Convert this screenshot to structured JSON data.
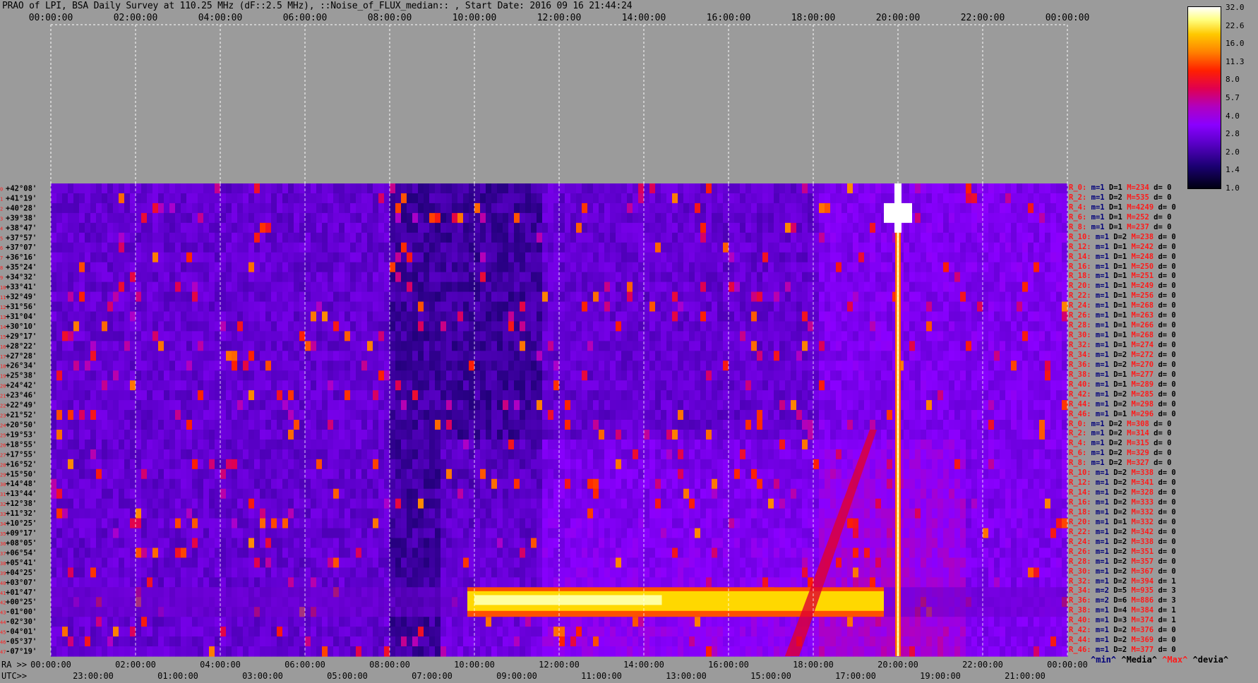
{
  "title": "PRAO of LPI, BSA Daily Survey at 110.25 MHz (dF::2.5 MHz), ::Noise_of_FLUX_median:: , Start Date: 2016 09 16 21:44:24",
  "chart_data": {
    "type": "heatmap",
    "top_axis_labels": [
      "00:00:00",
      "02:00:00",
      "04:00:00",
      "06:00:00",
      "08:00:00",
      "10:00:00",
      "12:00:00",
      "14:00:00",
      "16:00:00",
      "18:00:00",
      "20:00:00",
      "22:00:00",
      "00:00:00"
    ],
    "ra_label": "RA >>",
    "utc_label": "UTC>>",
    "ra_axis_labels": [
      "00:00:00",
      "02:00:00",
      "04:00:00",
      "06:00:00",
      "08:00:00",
      "10:00:00",
      "12:00:00",
      "14:00:00",
      "16:00:00",
      "18:00:00",
      "20:00:00",
      "22:00:00",
      "00:00:00"
    ],
    "utc_axis_labels": [
      "23:00:00",
      "01:00:00",
      "03:00:00",
      "05:00:00",
      "07:00:00",
      "09:00:00",
      "11:00:00",
      "13:00:00",
      "15:00:00",
      "17:00:00",
      "19:00:00",
      "21:00:00"
    ],
    "declinations": [
      "+42°08'",
      "+41°19'",
      "+40°28'",
      "+39°38'",
      "+38°47'",
      "+37°57'",
      "+37°07'",
      "+36°16'",
      "+35°24'",
      "+34°32'",
      "+33°41'",
      "+32°49'",
      "+31°56'",
      "+31°04'",
      "+30°10'",
      "+29°17'",
      "+28°22'",
      "+27°28'",
      "+26°34'",
      "+25°38'",
      "+24°42'",
      "+23°46'",
      "+22°49'",
      "+21°52'",
      "+20°50'",
      "+19°53'",
      "+18°55'",
      "+17°55'",
      "+16°52'",
      "+15°50'",
      "+14°48'",
      "+13°44'",
      "+12°38'",
      "+11°32'",
      "+10°25'",
      "+09°17'",
      "+08°05'",
      "+06°54'",
      "+05°41'",
      "+04°25'",
      "+03°07'",
      "+01°47'",
      "+00°25'",
      "-01°00'",
      "-02°30'",
      "-04°01'",
      "-05°37'",
      "-07°19'"
    ],
    "colorbar_ticks": [
      "32.0",
      "22.6",
      "16.0",
      "11.3",
      "8.0",
      "5.7",
      "4.0",
      "2.8",
      "2.0",
      "1.4",
      "1.0"
    ],
    "colorbar_scale": "log",
    "colorbar_colors": [
      "#000011",
      "#5a00c8",
      "#8a00ff",
      "#e00050",
      "#ff8000",
      "#ffff80",
      "#ffffff"
    ],
    "bright_band_dec": "+00°25'",
    "bright_band_ra_range": [
      "10:00:00",
      "18:00:00"
    ],
    "source_ra": "20:00:00",
    "source_dec_range": [
      "+42°08'",
      "-07°19'"
    ],
    "legend": {
      "min": "^min^",
      "median": "^Media^",
      "max": "^Max^",
      "devia": "^devia^"
    }
  },
  "rows": [
    {
      "r": "R_0:",
      "m": "m=1",
      "d": "D=1",
      "M": "M=234",
      "dv": "d= 0"
    },
    {
      "r": "R_2:",
      "m": "m=1",
      "d": "D=2",
      "M": "M=535",
      "dv": "d= 0"
    },
    {
      "r": "R_4:",
      "m": "m=1",
      "d": "D=1",
      "M": "M=4249",
      "dv": "d= 0"
    },
    {
      "r": "R_6:",
      "m": "m=1",
      "d": "D=1",
      "M": "M=252",
      "dv": "d= 0"
    },
    {
      "r": "R_8:",
      "m": "m=1",
      "d": "D=1",
      "M": "M=237",
      "dv": "d= 0"
    },
    {
      "r": "R_10:",
      "m": "m=1",
      "d": "D=2",
      "M": "M=238",
      "dv": "d= 0"
    },
    {
      "r": "R_12:",
      "m": "m=1",
      "d": "D=1",
      "M": "M=242",
      "dv": "d= 0"
    },
    {
      "r": "R_14:",
      "m": "m=1",
      "d": "D=1",
      "M": "M=248",
      "dv": "d= 0"
    },
    {
      "r": "R_16:",
      "m": "m=1",
      "d": "D=1",
      "M": "M=250",
      "dv": "d= 0"
    },
    {
      "r": "R_18:",
      "m": "m=1",
      "d": "D=1",
      "M": "M=251",
      "dv": "d= 0"
    },
    {
      "r": "R_20:",
      "m": "m=1",
      "d": "D=1",
      "M": "M=249",
      "dv": "d= 0"
    },
    {
      "r": "R_22:",
      "m": "m=1",
      "d": "D=1",
      "M": "M=256",
      "dv": "d= 0"
    },
    {
      "r": "R_24:",
      "m": "m=1",
      "d": "D=1",
      "M": "M=268",
      "dv": "d= 0"
    },
    {
      "r": "R_26:",
      "m": "m=1",
      "d": "D=1",
      "M": "M=263",
      "dv": "d= 0"
    },
    {
      "r": "R_28:",
      "m": "m=1",
      "d": "D=1",
      "M": "M=266",
      "dv": "d= 0"
    },
    {
      "r": "R_30:",
      "m": "m=1",
      "d": "D=1",
      "M": "M=268",
      "dv": "d= 0"
    },
    {
      "r": "R_32:",
      "m": "m=1",
      "d": "D=1",
      "M": "M=274",
      "dv": "d= 0"
    },
    {
      "r": "R_34:",
      "m": "m=1",
      "d": "D=2",
      "M": "M=272",
      "dv": "d= 0"
    },
    {
      "r": "R_36:",
      "m": "m=1",
      "d": "D=2",
      "M": "M=270",
      "dv": "d= 0"
    },
    {
      "r": "R_38:",
      "m": "m=1",
      "d": "D=1",
      "M": "M=277",
      "dv": "d= 0"
    },
    {
      "r": "R_40:",
      "m": "m=1",
      "d": "D=1",
      "M": "M=289",
      "dv": "d= 0"
    },
    {
      "r": "R_42:",
      "m": "m=1",
      "d": "D=2",
      "M": "M=285",
      "dv": "d= 0"
    },
    {
      "r": "R_44:",
      "m": "m=1",
      "d": "D=2",
      "M": "M=298",
      "dv": "d= 0"
    },
    {
      "r": "R_46:",
      "m": "m=1",
      "d": "D=1",
      "M": "M=296",
      "dv": "d= 0"
    },
    {
      "r": "R_0:",
      "m": "m=1",
      "d": "D=2",
      "M": "M=308",
      "dv": "d= 0"
    },
    {
      "r": "R_2:",
      "m": "m=1",
      "d": "D=2",
      "M": "M=314",
      "dv": "d= 0"
    },
    {
      "r": "R_4:",
      "m": "m=1",
      "d": "D=2",
      "M": "M=315",
      "dv": "d= 0"
    },
    {
      "r": "R_6:",
      "m": "m=1",
      "d": "D=2",
      "M": "M=329",
      "dv": "d= 0"
    },
    {
      "r": "R_8:",
      "m": "m=1",
      "d": "D=2",
      "M": "M=327",
      "dv": "d= 0"
    },
    {
      "r": "R_10:",
      "m": "m=1",
      "d": "D=2",
      "M": "M=338",
      "dv": "d= 0"
    },
    {
      "r": "R_12:",
      "m": "m=1",
      "d": "D=2",
      "M": "M=341",
      "dv": "d= 0"
    },
    {
      "r": "R_14:",
      "m": "m=1",
      "d": "D=2",
      "M": "M=328",
      "dv": "d= 0"
    },
    {
      "r": "R_16:",
      "m": "m=1",
      "d": "D=2",
      "M": "M=333",
      "dv": "d= 0"
    },
    {
      "r": "R_18:",
      "m": "m=1",
      "d": "D=2",
      "M": "M=332",
      "dv": "d= 0"
    },
    {
      "r": "R_20:",
      "m": "m=1",
      "d": "D=1",
      "M": "M=332",
      "dv": "d= 0"
    },
    {
      "r": "R_22:",
      "m": "m=1",
      "d": "D=2",
      "M": "M=342",
      "dv": "d= 0"
    },
    {
      "r": "R_24:",
      "m": "m=1",
      "d": "D=2",
      "M": "M=338",
      "dv": "d= 0"
    },
    {
      "r": "R_26:",
      "m": "m=1",
      "d": "D=2",
      "M": "M=351",
      "dv": "d= 0"
    },
    {
      "r": "R_28:",
      "m": "m=1",
      "d": "D=2",
      "M": "M=357",
      "dv": "d= 0"
    },
    {
      "r": "R_30:",
      "m": "m=1",
      "d": "D=2",
      "M": "M=367",
      "dv": "d= 0"
    },
    {
      "r": "R_32:",
      "m": "m=1",
      "d": "D=2",
      "M": "M=394",
      "dv": "d= 1"
    },
    {
      "r": "R_34:",
      "m": "m=2",
      "d": "D=5",
      "M": "M=935",
      "dv": "d= 3"
    },
    {
      "r": "R_36:",
      "m": "m=2",
      "d": "D=6",
      "M": "M=886",
      "dv": "d= 3"
    },
    {
      "r": "R_38:",
      "m": "m=1",
      "d": "D=4",
      "M": "M=384",
      "dv": "d= 1"
    },
    {
      "r": "R_40:",
      "m": "m=1",
      "d": "D=3",
      "M": "M=374",
      "dv": "d= 1"
    },
    {
      "r": "R_42:",
      "m": "m=1",
      "d": "D=2",
      "M": "M=376",
      "dv": "d= 0"
    },
    {
      "r": "R_44:",
      "m": "m=1",
      "d": "D=2",
      "M": "M=369",
      "dv": "d= 0"
    },
    {
      "r": "R_46:",
      "m": "m=1",
      "d": "D=2",
      "M": "M=377",
      "dv": "d= 0"
    }
  ]
}
